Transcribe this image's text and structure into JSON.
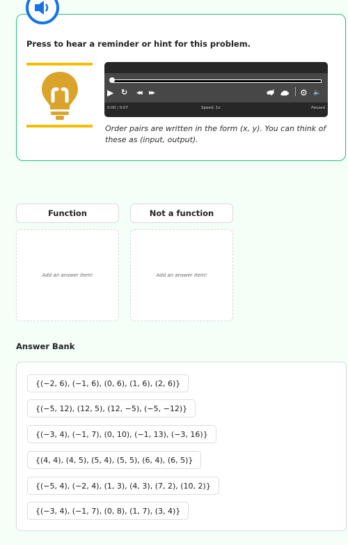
{
  "hint": {
    "title": "Press to hear a reminder or hint for this problem.",
    "text": "Order pairs are written in the form (x, y). You can think of these as (input, output).",
    "player": {
      "time": "0:00 / 0:07",
      "speed": "Speed: 1x",
      "status": "Paused",
      "progress": 0,
      "icons": {
        "play": "▶",
        "replay": "↻",
        "rewind": "◀◀",
        "forward": "▶▶",
        "settings": "⚙",
        "volume": "🔈"
      }
    }
  },
  "categories": [
    {
      "label": "Function",
      "placeholder": "Add an answer item!"
    },
    {
      "label": "Not a function",
      "placeholder": "Add an answer item!"
    }
  ],
  "answer_bank": {
    "label": "Answer Bank",
    "items": [
      "{(−2, 6), (−1, 6), (0, 6), (1, 6), (2, 6)}",
      "{(−5, 12), (12, 5), (12, −5), (−5, −12)}",
      "{(−3, 4), (−1, 7), (0, 10), (−1, 13), (−3, 16)}",
      "{(4, 4), (4, 5), (5, 4), (5, 5), (6, 4), (6, 5)}",
      "{(−5, 4), (−2, 4), (1, 3), (4, 3), (7, 2), (10, 2)}",
      "{(−3, 4), (−1, 7), (0, 8), (1, 7), (3, 4)}"
    ]
  },
  "colors": {
    "accent_blue": "#1573e6",
    "card_border_green": "#1fbf79",
    "bulb_gold": "#daa32c",
    "bulb_bar": "#f5bd02",
    "page_bg": "#f4fff8"
  }
}
